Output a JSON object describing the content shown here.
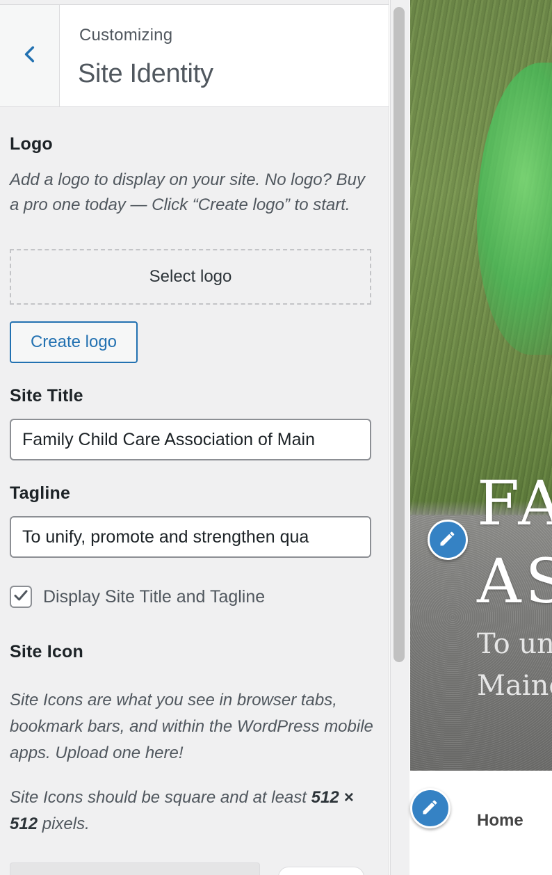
{
  "header": {
    "small_title": "Customizing",
    "title": "Site Identity"
  },
  "logo_section": {
    "label": "Logo",
    "description": "Add a logo to display on your site. No logo? Buy a pro one today — Click “Create logo” to start.",
    "select_button": "Select logo",
    "create_button": "Create logo"
  },
  "site_title": {
    "label": "Site Title",
    "value": "Family Child Care Association of Main"
  },
  "tagline": {
    "label": "Tagline",
    "value": "To unify, promote and strengthen qua"
  },
  "display_toggle": {
    "label": "Display Site Title and Tagline",
    "checked": true
  },
  "site_icon": {
    "label": "Site Icon",
    "description": "Site Icons are what you see in browser tabs, bookmark bars, and within the WordPress mobile apps. Upload one here!",
    "requirement_prefix": "Site Icons should be square and at least",
    "requirement_size": "512 × 512",
    "requirement_suffix": "pixels."
  },
  "preview": {
    "hero_title": "FA AS",
    "hero_title_line1": "FA",
    "hero_title_line2": "AS",
    "hero_tagline_line1": "To un",
    "hero_tagline_line2": "Maine",
    "nav_home": "Home"
  },
  "colors": {
    "accent": "#2271b1",
    "edit_pen": "#3582c4",
    "panel_bg": "#f0f0f1"
  },
  "icons": {
    "back": "chevron-left-icon",
    "checkbox": "checkmark-icon",
    "edit": "pencil-icon"
  }
}
